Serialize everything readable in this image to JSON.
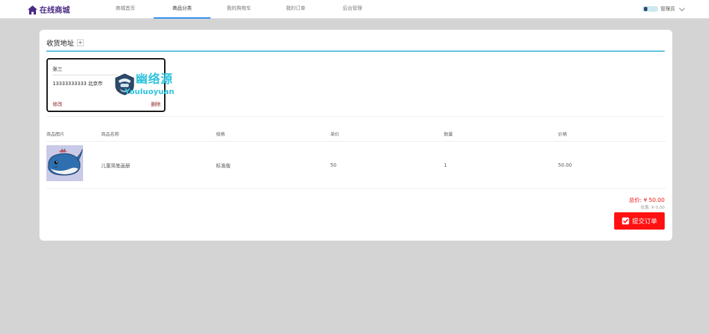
{
  "header": {
    "logo_text": "在线商城",
    "nav": [
      {
        "label": "商城首页"
      },
      {
        "label": "商品分类"
      },
      {
        "label": "我的购物车"
      },
      {
        "label": "我的订单"
      },
      {
        "label": "后台管理"
      }
    ],
    "active_nav": "商品分类",
    "user_label": "管理员"
  },
  "address": {
    "section_title": "收货地址",
    "add_label": "+",
    "name": "张三",
    "detail": "13333333333 北京市",
    "edit_label": "修改",
    "delete_label": "删除"
  },
  "watermark": {
    "title": "幽络源",
    "subtitle": "Youluoyuan"
  },
  "table": {
    "columns": [
      "商品图片",
      "商品名称",
      "规格",
      "单价",
      "数量",
      "价格"
    ],
    "rows": [
      {
        "name": "儿童简笔画册",
        "spec": "标准版",
        "unit_price": "50",
        "quantity": "1",
        "price": "50.00"
      }
    ]
  },
  "summary": {
    "total": "总价:  ¥ 50.00",
    "discount": "优惠:   ¥ 0.00",
    "submit_label": "提交订单"
  },
  "colors": {
    "brand": "#4b2a84",
    "accent": "#5bc0de",
    "danger": "#ff1111"
  }
}
